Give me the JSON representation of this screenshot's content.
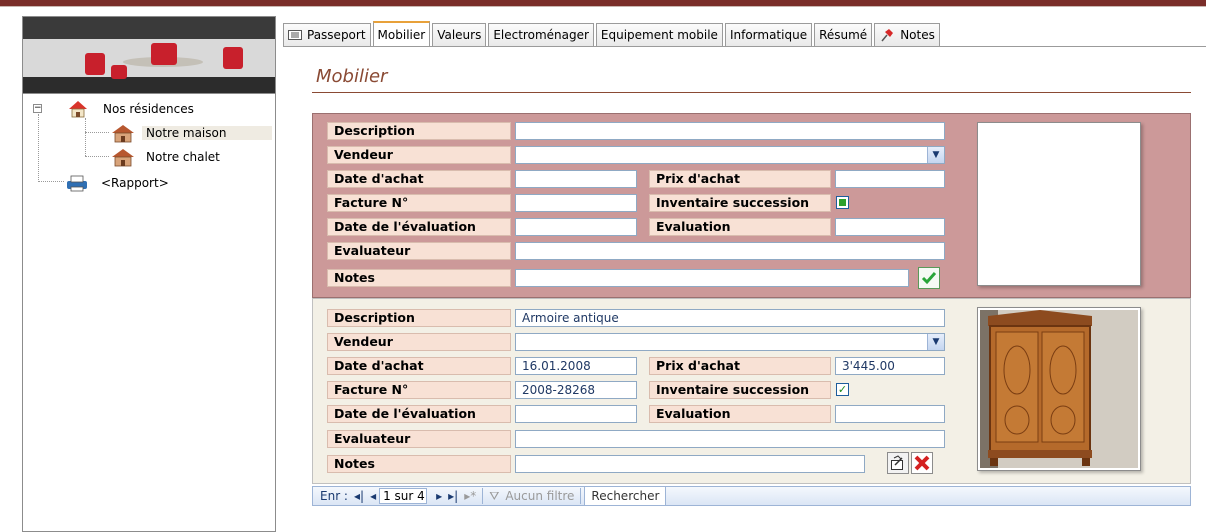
{
  "colors": {
    "topbar": "#7a2e2a",
    "record_current_bg": "#cc9999",
    "record_bg": "#f3f0e6",
    "label_bg": "#f8e1d5",
    "title": "#8a4a34"
  },
  "tree": {
    "root": "Nos résidences",
    "items": [
      "Notre maison",
      "Notre chalet"
    ],
    "report": "<Rapport>"
  },
  "tabs": [
    "Passeport",
    "Mobilier",
    "Valeurs",
    "Electroménager",
    "Equipement mobile",
    "Informatique",
    "Résumé",
    "Notes"
  ],
  "form": {
    "title": "Mobilier",
    "labels": {
      "description": "Description",
      "vendeur": "Vendeur",
      "date_achat": "Date d'achat",
      "prix_achat": "Prix d'achat",
      "facture": "Facture N°",
      "inventaire": "Inventaire succession",
      "date_evaluation": "Date de l'évaluation",
      "evaluation": "Evaluation",
      "evaluateur": "Evaluateur",
      "notes": "Notes"
    },
    "records": [
      {
        "description": "",
        "vendeur": "",
        "date_achat": "",
        "prix_achat": "",
        "facture": "",
        "inventaire_checked": false,
        "date_evaluation": "",
        "evaluation": "",
        "evaluateur": "",
        "notes": ""
      },
      {
        "description": "Armoire antique",
        "vendeur": "",
        "date_achat": "16.01.2008",
        "prix_achat": "3'445.00",
        "facture": "2008-28268",
        "inventaire_checked": true,
        "date_evaluation": "",
        "evaluation": "",
        "evaluateur": "",
        "notes": ""
      }
    ]
  },
  "navbar": {
    "label": "Enr :",
    "record": "1 sur 4",
    "filter": "Aucun filtre",
    "search": "Rechercher"
  }
}
